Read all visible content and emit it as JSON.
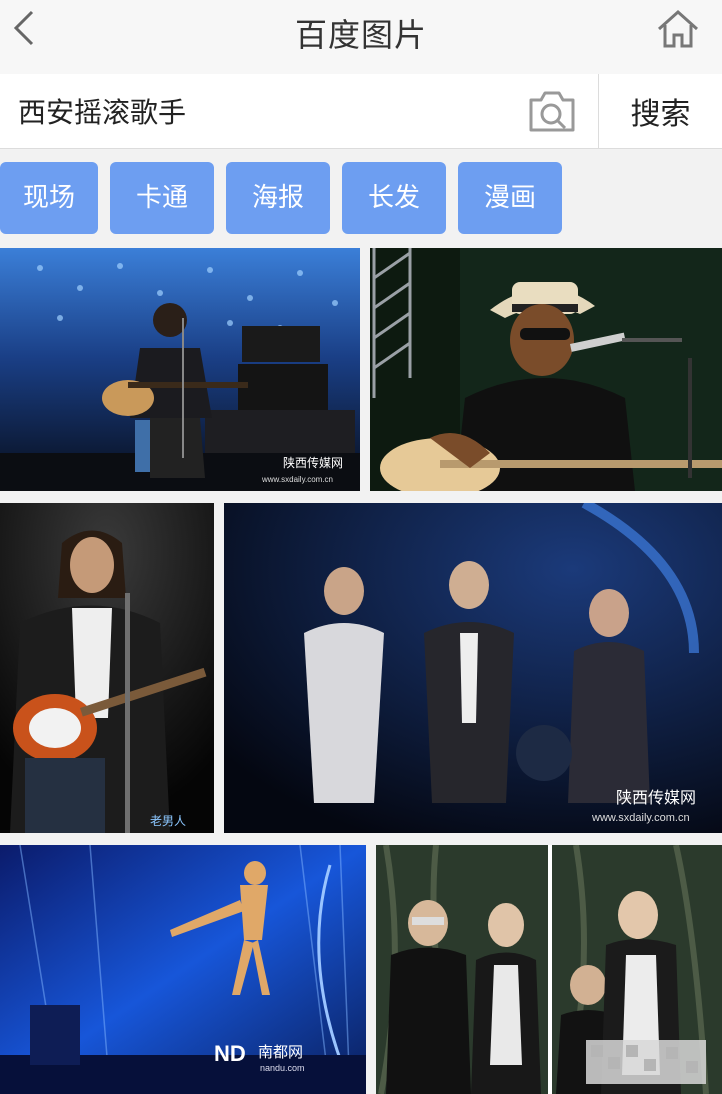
{
  "header": {
    "title": "百度图片"
  },
  "search": {
    "value": "西安摇滚歌手",
    "button_label": "搜索"
  },
  "tags": [
    "现场",
    "卡通",
    "海报",
    "长发",
    "漫画"
  ],
  "watermarks": {
    "shaanxi": "陕西传媒网",
    "shaanxi_url": "www.sxdaily.com.cn",
    "laonanren": "老男人",
    "nandu_logo": "ND",
    "nandu": "南都网",
    "nandu_url": "nandu.com"
  }
}
